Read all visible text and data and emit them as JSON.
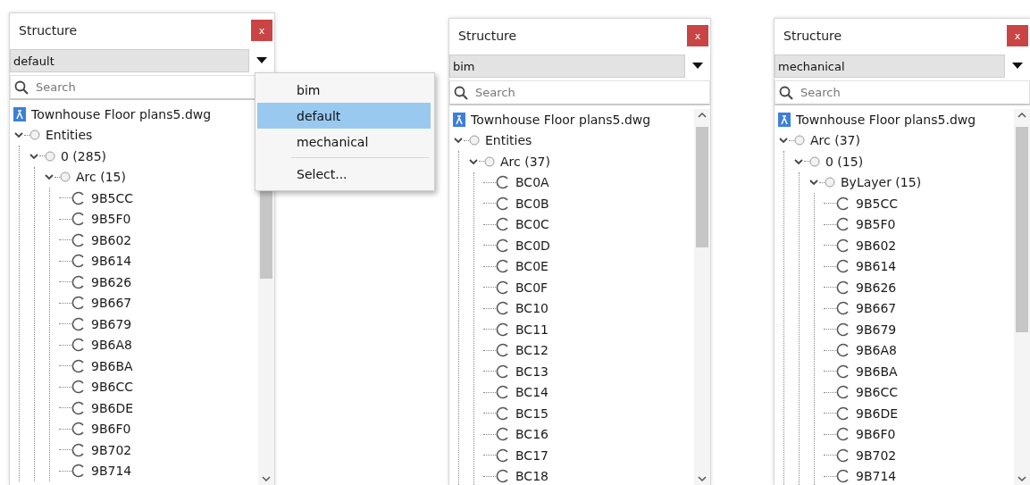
{
  "panels": [
    {
      "title": "Structure",
      "close": "x",
      "dropdown": {
        "value": "default"
      },
      "menu": [
        {
          "label": "bim",
          "kind": "option",
          "selected": false
        },
        {
          "label": "default",
          "kind": "option",
          "selected": true
        },
        {
          "label": "mechanical",
          "kind": "option",
          "selected": false
        },
        {
          "label": "Select...",
          "kind": "action",
          "selected": false
        }
      ],
      "search": {
        "placeholder": "Search"
      },
      "tree": {
        "label": "Townhouse Floor plans5.dwg",
        "kind": "file",
        "children": [
          {
            "label": "Entities",
            "kind": "group",
            "expanded": true,
            "children": [
              {
                "label": "0 (285)",
                "kind": "group",
                "expanded": true,
                "children": [
                  {
                    "label": "Arc (15)",
                    "kind": "group",
                    "expanded": true,
                    "children": [
                      {
                        "label": "9B5CC",
                        "kind": "item"
                      },
                      {
                        "label": "9B5F0",
                        "kind": "item"
                      },
                      {
                        "label": "9B602",
                        "kind": "item"
                      },
                      {
                        "label": "9B614",
                        "kind": "item"
                      },
                      {
                        "label": "9B626",
                        "kind": "item"
                      },
                      {
                        "label": "9B667",
                        "kind": "item"
                      },
                      {
                        "label": "9B679",
                        "kind": "item"
                      },
                      {
                        "label": "9B6A8",
                        "kind": "item"
                      },
                      {
                        "label": "9B6BA",
                        "kind": "item"
                      },
                      {
                        "label": "9B6CC",
                        "kind": "item"
                      },
                      {
                        "label": "9B6DE",
                        "kind": "item"
                      },
                      {
                        "label": "9B6F0",
                        "kind": "item"
                      },
                      {
                        "label": "9B702",
                        "kind": "item"
                      },
                      {
                        "label": "9B714",
                        "kind": "item"
                      }
                    ]
                  }
                ]
              }
            ]
          }
        ]
      }
    },
    {
      "title": "Structure",
      "close": "x",
      "dropdown": {
        "value": "bim"
      },
      "search": {
        "placeholder": "Search"
      },
      "tree": {
        "label": "Townhouse Floor plans5.dwg",
        "kind": "file",
        "children": [
          {
            "label": "Entities",
            "kind": "group",
            "expanded": true,
            "children": [
              {
                "label": "Arc (37)",
                "kind": "group",
                "expanded": true,
                "children": [
                  {
                    "label": "BC0A",
                    "kind": "item"
                  },
                  {
                    "label": "BC0B",
                    "kind": "item"
                  },
                  {
                    "label": "BC0C",
                    "kind": "item"
                  },
                  {
                    "label": "BC0D",
                    "kind": "item"
                  },
                  {
                    "label": "BC0E",
                    "kind": "item"
                  },
                  {
                    "label": "BC0F",
                    "kind": "item"
                  },
                  {
                    "label": "BC10",
                    "kind": "item"
                  },
                  {
                    "label": "BC11",
                    "kind": "item"
                  },
                  {
                    "label": "BC12",
                    "kind": "item"
                  },
                  {
                    "label": "BC13",
                    "kind": "item"
                  },
                  {
                    "label": "BC14",
                    "kind": "item"
                  },
                  {
                    "label": "BC15",
                    "kind": "item"
                  },
                  {
                    "label": "BC16",
                    "kind": "item"
                  },
                  {
                    "label": "BC17",
                    "kind": "item"
                  },
                  {
                    "label": "BC18",
                    "kind": "item"
                  }
                ]
              }
            ]
          }
        ]
      }
    },
    {
      "title": "Structure",
      "close": "x",
      "dropdown": {
        "value": "mechanical"
      },
      "search": {
        "placeholder": "Search"
      },
      "tree": {
        "label": "Townhouse Floor plans5.dwg",
        "kind": "file",
        "children": [
          {
            "label": "Arc (37)",
            "kind": "group",
            "expanded": true,
            "children": [
              {
                "label": "0 (15)",
                "kind": "group",
                "expanded": true,
                "children": [
                  {
                    "label": "ByLayer (15)",
                    "kind": "group",
                    "expanded": true,
                    "children": [
                      {
                        "label": "9B5CC",
                        "kind": "item"
                      },
                      {
                        "label": "9B5F0",
                        "kind": "item"
                      },
                      {
                        "label": "9B602",
                        "kind": "item"
                      },
                      {
                        "label": "9B614",
                        "kind": "item"
                      },
                      {
                        "label": "9B626",
                        "kind": "item"
                      },
                      {
                        "label": "9B667",
                        "kind": "item"
                      },
                      {
                        "label": "9B679",
                        "kind": "item"
                      },
                      {
                        "label": "9B6A8",
                        "kind": "item"
                      },
                      {
                        "label": "9B6BA",
                        "kind": "item"
                      },
                      {
                        "label": "9B6CC",
                        "kind": "item"
                      },
                      {
                        "label": "9B6DE",
                        "kind": "item"
                      },
                      {
                        "label": "9B6F0",
                        "kind": "item"
                      },
                      {
                        "label": "9B702",
                        "kind": "item"
                      },
                      {
                        "label": "9B714",
                        "kind": "item"
                      }
                    ]
                  }
                ]
              }
            ]
          }
        ]
      }
    }
  ]
}
